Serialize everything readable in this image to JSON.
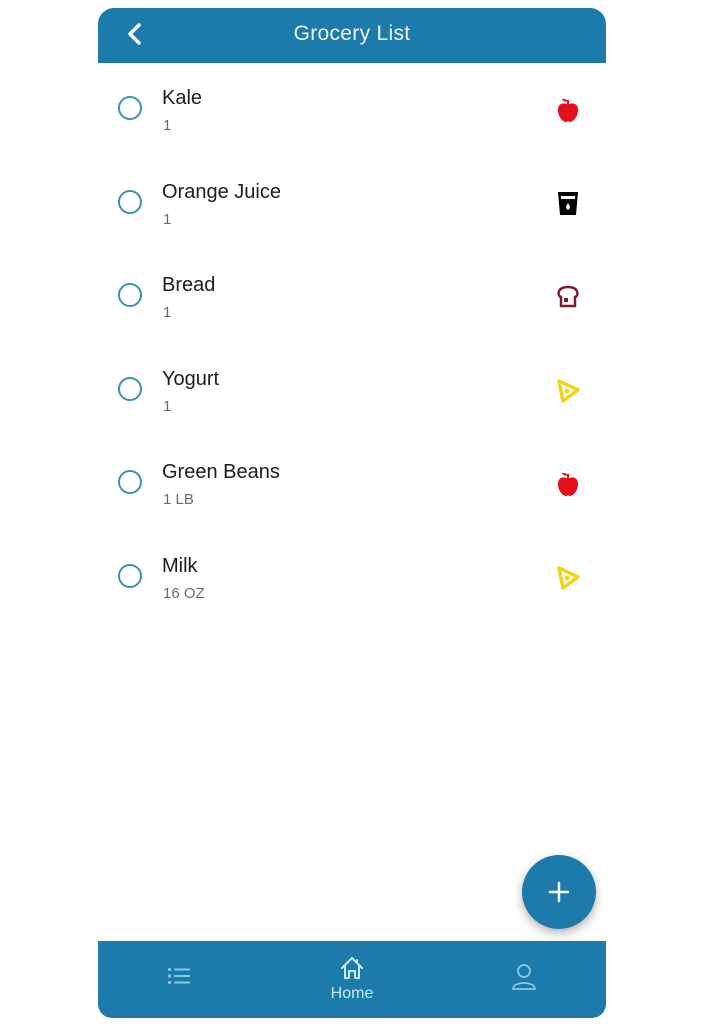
{
  "header": {
    "title": "Grocery List",
    "back_icon": "chevron-left-icon"
  },
  "items": [
    {
      "name": "Kale",
      "quantity": "1",
      "category_icon": "apple-icon",
      "category_color": "#e3101b"
    },
    {
      "name": "Orange Juice",
      "quantity": "1",
      "category_icon": "drink-cup-icon",
      "category_color": "#000000"
    },
    {
      "name": "Bread",
      "quantity": "1",
      "category_icon": "bread-icon",
      "category_color": "#7a1c2a"
    },
    {
      "name": "Yogurt",
      "quantity": "1",
      "category_icon": "cheese-icon",
      "category_color": "#f0d41a"
    },
    {
      "name": "Green Beans",
      "quantity": "1 LB",
      "category_icon": "apple-icon",
      "category_color": "#e3101b"
    },
    {
      "name": "Milk",
      "quantity": "16 OZ",
      "category_icon": "cheese-icon",
      "category_color": "#f0d41a"
    }
  ],
  "fab": {
    "icon": "plus-icon"
  },
  "nav": {
    "items": [
      {
        "icon": "list-icon",
        "label": ""
      },
      {
        "icon": "home-icon",
        "label": "Home"
      },
      {
        "icon": "user-icon",
        "label": ""
      }
    ]
  },
  "colors": {
    "primary": "#1d7bab",
    "checkbox": "#3a93a8",
    "nav_active": "#c8ecfb"
  }
}
